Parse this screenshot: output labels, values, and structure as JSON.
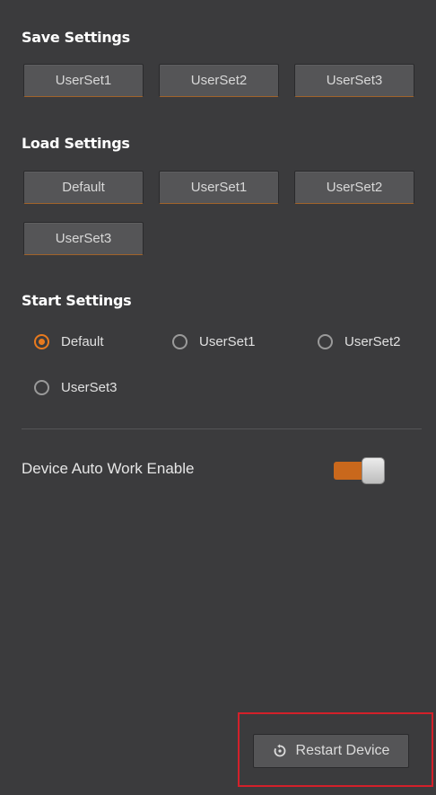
{
  "save_settings": {
    "title": "Save Settings",
    "buttons": [
      "UserSet1",
      "UserSet2",
      "UserSet3"
    ]
  },
  "load_settings": {
    "title": "Load Settings",
    "buttons": [
      "Default",
      "UserSet1",
      "UserSet2",
      "UserSet3"
    ]
  },
  "start_settings": {
    "title": "Start Settings",
    "options": [
      "Default",
      "UserSet1",
      "UserSet2",
      "UserSet3"
    ],
    "selected": "Default"
  },
  "device_auto_work": {
    "label": "Device Auto Work Enable",
    "enabled": true
  },
  "restart": {
    "label": "Restart Device",
    "icon": "restart-icon"
  },
  "colors": {
    "background": "#3b3b3d",
    "accent": "#e87a1e",
    "highlight": "#d3202a"
  }
}
